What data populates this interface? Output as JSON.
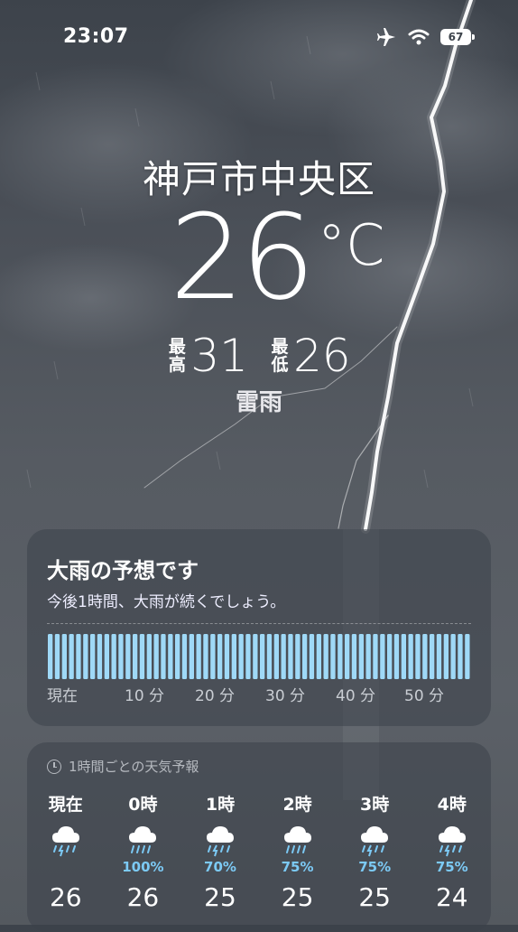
{
  "status": {
    "time": "23:07",
    "battery": "67"
  },
  "weather": {
    "location": "神戸市中央区",
    "temp": "26",
    "unit": "°C",
    "high_label": "最高",
    "high": "31",
    "low_label": "最低",
    "low": "26",
    "condition": "雷雨"
  },
  "precip_card": {
    "title": "大雨の予想です",
    "subtitle": "今後1時間、大雨が続くでしょう。",
    "axis": [
      "現在",
      "10 分",
      "20 分",
      "30 分",
      "40 分",
      "50 分"
    ]
  },
  "hourly": {
    "header": "1時間ごとの天気予報",
    "items": [
      {
        "hour": "現在",
        "icon": "thunderstorm-icon",
        "pct": "",
        "temp": "26"
      },
      {
        "hour": "0時",
        "icon": "heavy-rain-icon",
        "pct": "100%",
        "temp": "26"
      },
      {
        "hour": "1時",
        "icon": "thunderstorm-icon",
        "pct": "70%",
        "temp": "25"
      },
      {
        "hour": "2時",
        "icon": "heavy-rain-icon",
        "pct": "75%",
        "temp": "25"
      },
      {
        "hour": "3時",
        "icon": "thunderstorm-icon",
        "pct": "75%",
        "temp": "25"
      },
      {
        "hour": "4時",
        "icon": "thunderstorm-icon",
        "pct": "75%",
        "temp": "24"
      }
    ]
  },
  "colors": {
    "accent": "#7ccaf5",
    "bar": "#9fd9f7"
  }
}
